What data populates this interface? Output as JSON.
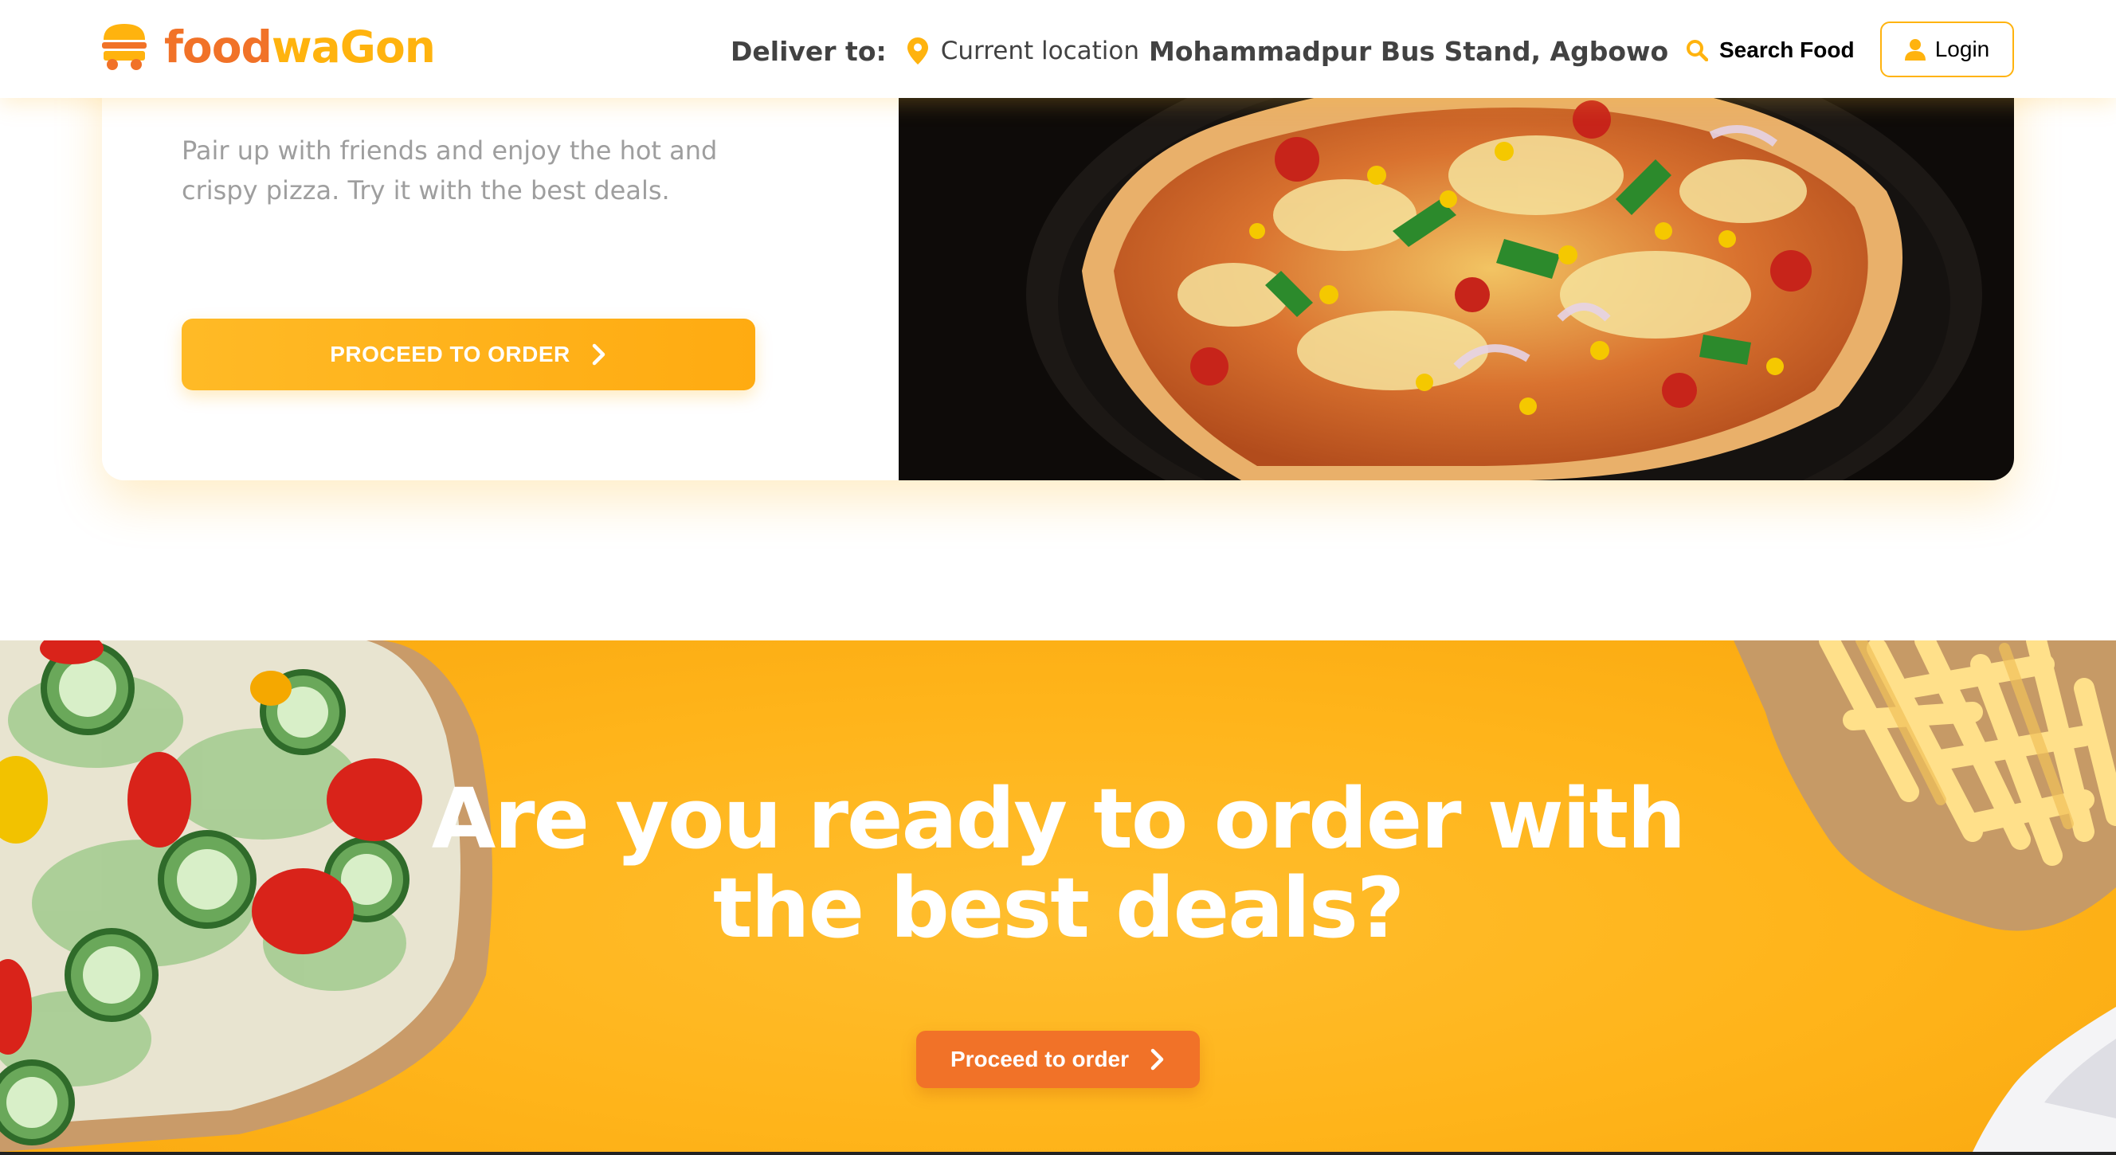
{
  "navbar": {
    "brand": {
      "part1": "food",
      "part2": "waGon"
    },
    "deliver_label": "Deliver to:",
    "current_location": "Current location",
    "address": "Mohammadpur Bus Stand, Agbowo",
    "search_label": "Search Food",
    "login_label": "Login"
  },
  "hero": {
    "description": "Pair up with friends and enjoy the hot and crispy pizza. Try it with the best deals.",
    "button_label": "PROCEED TO ORDER"
  },
  "cta": {
    "headline": "Are you ready to order with the best deals?",
    "button_label": "Proceed to order"
  },
  "colors": {
    "primary_orange": "#f17228",
    "primary_yellow": "#ffb30e",
    "text_dark": "#424242",
    "text_muted": "#9e9e9e"
  },
  "icons": [
    "burger-logo-icon",
    "location-pin-icon",
    "search-icon",
    "user-icon",
    "chevron-right-icon"
  ]
}
